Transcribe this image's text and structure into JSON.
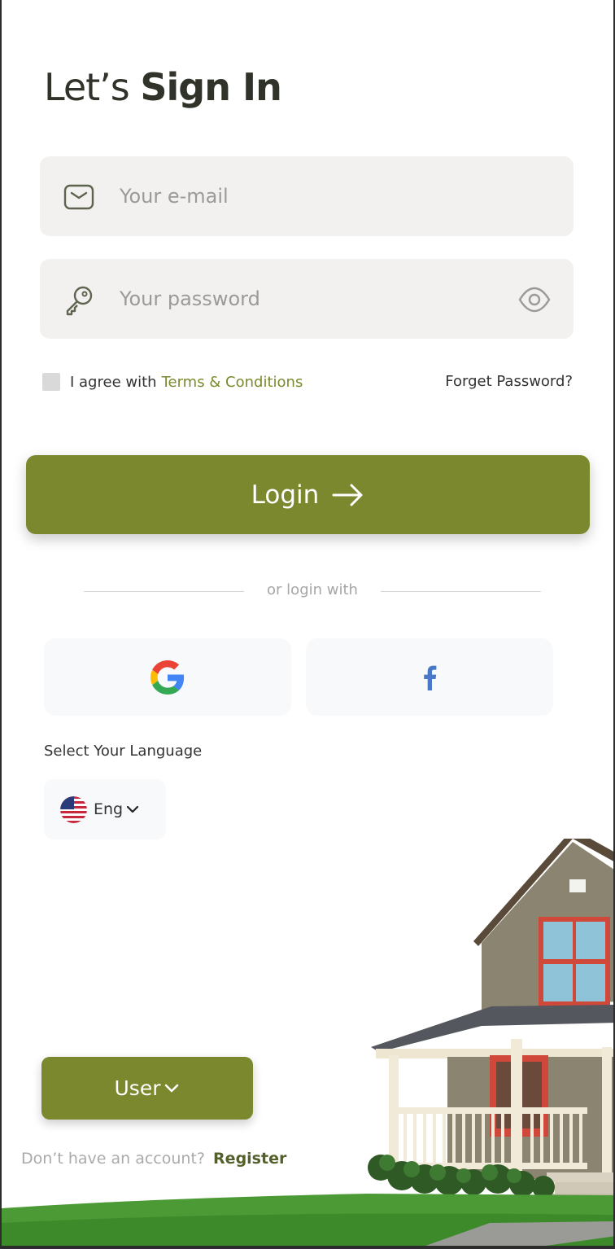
{
  "header": {
    "title_light": "Let’s",
    "title_bold": "Sign In"
  },
  "form": {
    "email_placeholder": "Your e-mail",
    "password_placeholder": "Your password",
    "agree_prefix": "I agree with",
    "terms_label": "Terms & Conditions",
    "forget_label": "Forget Password?",
    "login_label": "Login"
  },
  "divider": {
    "text": "or login with"
  },
  "social": {
    "google": "google-icon",
    "facebook": "facebook-icon"
  },
  "language": {
    "label": "Select Your Language",
    "selected": "Eng"
  },
  "role": {
    "selected": "User"
  },
  "footer": {
    "prompt": "Don’t have an account?",
    "register_label": "Register"
  },
  "colors": {
    "accent": "#7b882e",
    "terms": "#7a8a2d",
    "field_bg": "#f2f1ef",
    "social_bg": "#f7f9fb"
  }
}
